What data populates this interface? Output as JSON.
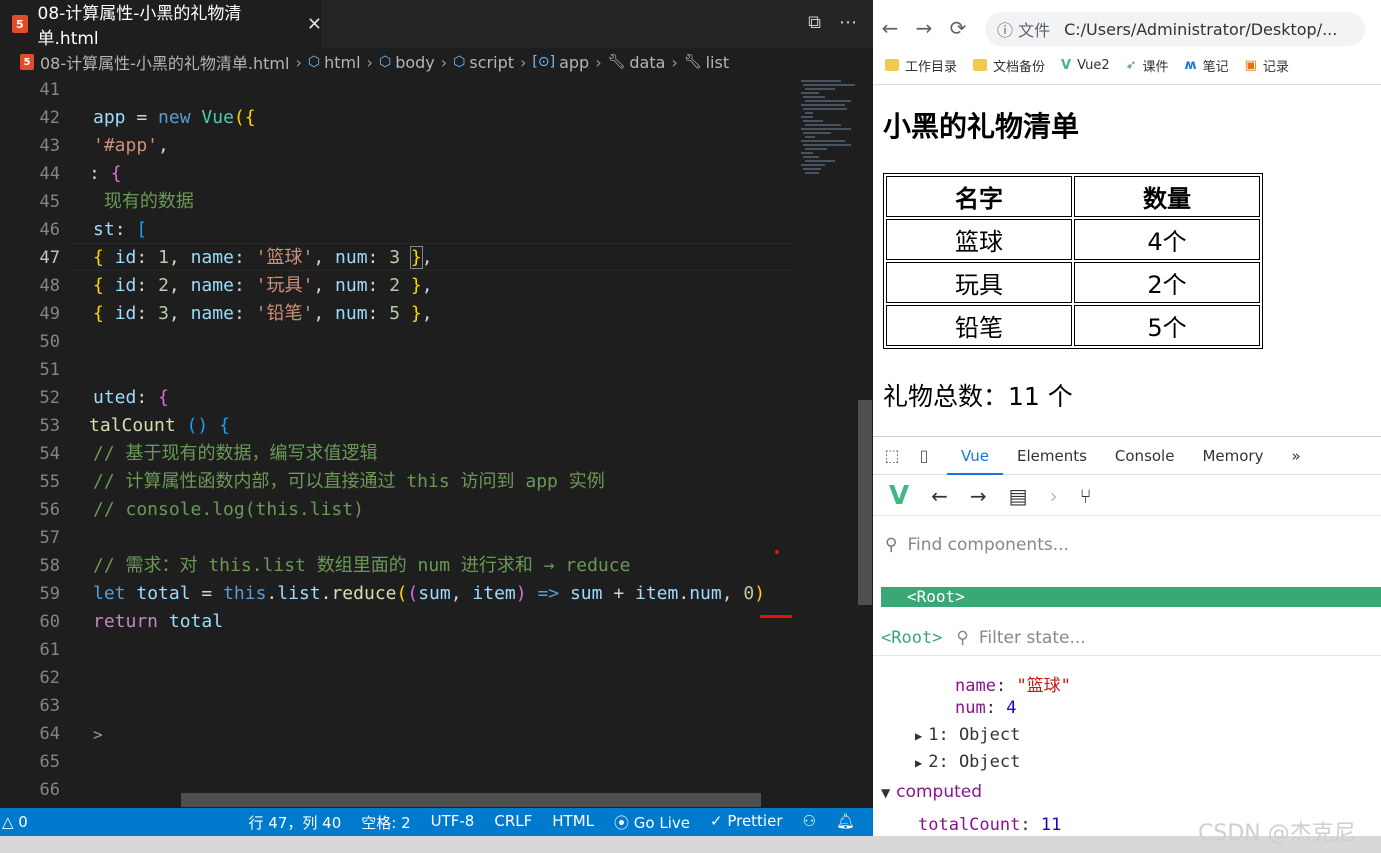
{
  "editor": {
    "tab_title": "08-计算属性-小黑的礼物清单.html",
    "tab_close": "✕",
    "tab_icon": "5",
    "split_icon": "⧉",
    "more_icon": "⋯",
    "breadcrumb": [
      {
        "label": "08-计算属性-小黑的礼物清单.html",
        "icon": "html-file-icon"
      },
      {
        "label": "html",
        "icon": "cube-icon"
      },
      {
        "label": "body",
        "icon": "cube-icon"
      },
      {
        "label": "script",
        "icon": "cube-icon"
      },
      {
        "label": "app",
        "icon": "variable-icon"
      },
      {
        "label": "data",
        "icon": "wrench-icon"
      },
      {
        "label": "list",
        "icon": "wrench-icon"
      }
    ],
    "line_numbers": [
      "41",
      "42",
      "43",
      "44",
      "45",
      "46",
      "47",
      "48",
      "49",
      "50",
      "51",
      "52",
      "53",
      "54",
      "55",
      "56",
      "57",
      "58",
      "59",
      "60",
      "61",
      "62",
      "63",
      "64",
      "65",
      "66"
    ],
    "active_line": "47"
  },
  "status_bar": {
    "left": "△ 0",
    "position": "行 47，列 40",
    "indent": "空格: 2",
    "encoding": "UTF-8",
    "eol": "CRLF",
    "language": "HTML",
    "golive": "Go Live",
    "prettier": "✓ Prettier",
    "feedback_icon": "person-icon",
    "bell_icon": "bell-icon"
  },
  "browser": {
    "back": "←",
    "forward": "→",
    "reload": "⟳",
    "address_info": "ⓘ 文件",
    "address": "C:/Users/Administrator/Desktop/...",
    "bookmarks": [
      "工作目录",
      "文档备份",
      "Vue2",
      "课件",
      "笔记",
      "记录"
    ],
    "page": {
      "title": "小黑的礼物清单",
      "table_headers": [
        "名字",
        "数量"
      ],
      "rows": [
        [
          "篮球",
          "4个"
        ],
        [
          "玩具",
          "2个"
        ],
        [
          "铅笔",
          "5个"
        ]
      ],
      "total": "礼物总数：11 个"
    }
  },
  "devtools": {
    "tabs": [
      "Vue",
      "Elements",
      "Console",
      "Memory",
      "»"
    ],
    "active_tab": "Vue",
    "find_placeholder": "Find components...",
    "root": "<Root>",
    "filter_placeholder": "Filter state...",
    "state_name_key": "name",
    "state_name_val": "\"篮球\"",
    "state_num_key": "num",
    "state_num_val": "4",
    "obj1": "1: Object",
    "obj2": "2: Object",
    "computed_label": "computed",
    "computed_key": "totalCount",
    "computed_val": "11"
  },
  "watermark": "CSDN @杰克尼"
}
